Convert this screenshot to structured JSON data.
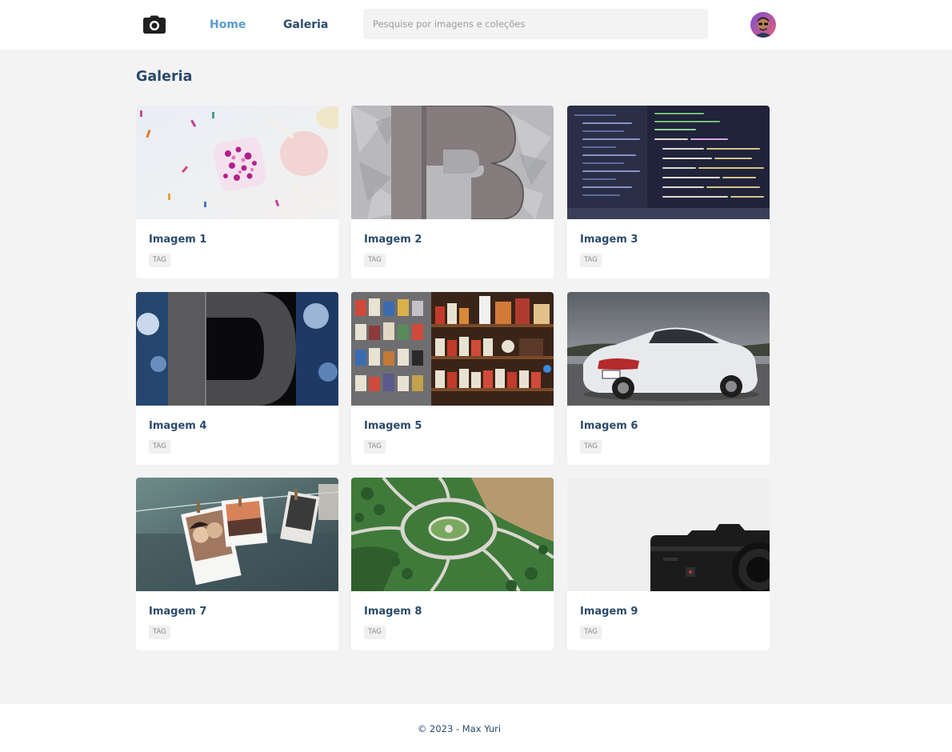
{
  "nav": {
    "logo_icon": "camera-icon",
    "home_label": "Home",
    "gallery_label": "Galeria",
    "active_color": "#5b9bd0"
  },
  "search": {
    "placeholder": "Pesquise por imagens e coleções",
    "value": ""
  },
  "user": {
    "avatar_icon": "avatar"
  },
  "main": {
    "title": "Galeria"
  },
  "cards": [
    {
      "title": "Imagem 1",
      "tag": "TAG",
      "image": "candy-jar-photo"
    },
    {
      "title": "Imagem 2",
      "tag": "TAG",
      "image": "metal-letter-b-photo"
    },
    {
      "title": "Imagem 3",
      "tag": "TAG",
      "image": "code-screen-photo"
    },
    {
      "title": "Imagem 4",
      "tag": "TAG",
      "image": "letter-d-sign-photo"
    },
    {
      "title": "Imagem 5",
      "tag": "TAG",
      "image": "shop-shelves-photo"
    },
    {
      "title": "Imagem 6",
      "tag": "TAG",
      "image": "white-sports-car-photo"
    },
    {
      "title": "Imagem 7",
      "tag": "TAG",
      "image": "hanging-polaroids-photo"
    },
    {
      "title": "Imagem 8",
      "tag": "TAG",
      "image": "aerial-park-photo"
    },
    {
      "title": "Imagem 9",
      "tag": "TAG",
      "image": "camera-photo"
    }
  ],
  "footer": {
    "text": "© 2023 - Max Yuri"
  },
  "colors": {
    "heading": "#2b4a6b",
    "background": "#f3f3f4",
    "card": "#ffffff"
  }
}
